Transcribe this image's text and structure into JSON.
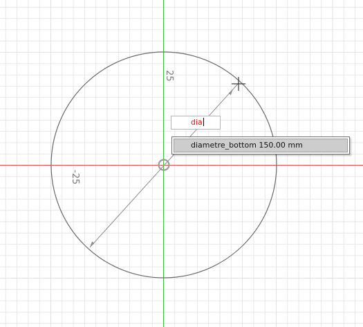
{
  "canvas": {
    "dimension_label": "25",
    "dimension_label_neg": "-25"
  },
  "input": {
    "value": "dia"
  },
  "suggestion": {
    "name": "diametre_bottom",
    "value": "150.00 mm"
  },
  "colors": {
    "grid": "#e3e3e3",
    "axis_x": "#e05050",
    "axis_y": "#40c040",
    "circle": "#6a6a6a",
    "dimension": "#8c8c8c",
    "typed_text": "#e01010"
  },
  "icons": [
    "center-point-icon",
    "crosshair-cursor-icon",
    "arrowhead-icon"
  ]
}
